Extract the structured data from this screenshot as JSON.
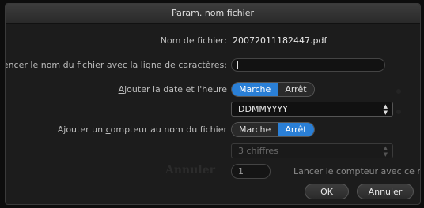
{
  "dialog": {
    "title": "Param. nom fichier"
  },
  "filename": {
    "label": "Nom de fichier:",
    "value": "20072011182447.pdf"
  },
  "prefix": {
    "label_pre": "Commencer le ",
    "label_u": "n",
    "label_post": "om du fichier avec la ligne de caractères:",
    "value": ""
  },
  "datetime": {
    "label_u": "A",
    "label_post": "jouter la date et l'heure",
    "on_label": "Marche",
    "off_label": "Arrêt",
    "selected": "Marche"
  },
  "date_format": {
    "value": "DDMMYYYY"
  },
  "counter": {
    "label_pre": "Ajouter un ",
    "label_u": "c",
    "label_post": "ompteur au nom du fichier",
    "on_label": "Marche",
    "off_label": "Arrêt",
    "selected": "Arrêt"
  },
  "digits": {
    "value": "3 chiffres"
  },
  "start_counter": {
    "value": "1",
    "label_pre": "Lan",
    "label_u": "c",
    "label_post": "er le compteur avec ce numéro"
  },
  "buttons": {
    "ok": "OK",
    "cancel": "Annuler"
  },
  "colors": {
    "accent": "#2a7fd6",
    "background": "#1c1c1c"
  }
}
